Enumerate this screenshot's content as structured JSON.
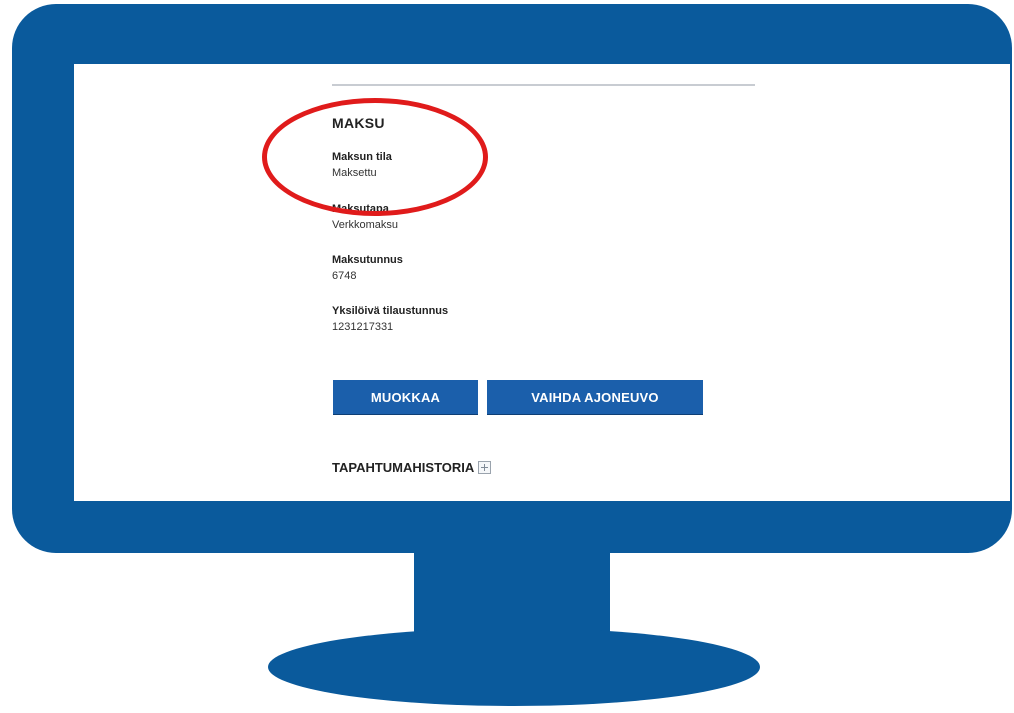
{
  "payment": {
    "section_title": "MAKSU",
    "status_label": "Maksun tila",
    "status_value": "Maksettu",
    "method_label": "Maksutapa",
    "method_value": "Verkkomaksu",
    "payment_id_label": "Maksutunnus",
    "payment_id_value": "6748",
    "order_id_label": "Yksilöivä tilaustunnus",
    "order_id_value": "1231217331"
  },
  "actions": {
    "edit_label": "MUOKKAA",
    "change_vehicle_label": "VAIHDA AJONEUVO"
  },
  "history": {
    "title": "TAPAHTUMAHISTORIA",
    "expand_icon": "plus-square-icon"
  },
  "colors": {
    "monitor": "#0a5a9c",
    "button": "#1b5fab",
    "highlight": "#e01b1b"
  }
}
